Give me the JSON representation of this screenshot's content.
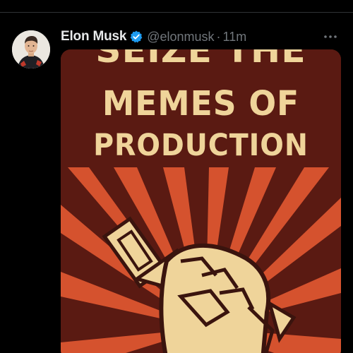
{
  "tweet": {
    "author": {
      "display_name": "Elon Musk",
      "handle": "@elonmusk",
      "verified": true
    },
    "separator": "·",
    "timestamp": "11m",
    "media": {
      "poster_lines": [
        "SEIZE THE",
        "MEMES OF",
        "PRODUCTION"
      ]
    }
  },
  "icons": {
    "verified": "verified-badge-icon",
    "more": "more-options-icon"
  },
  "colors": {
    "background": "#000000",
    "verified_badge": "#1d9bf0",
    "name_text": "#e7e9ea",
    "muted_text": "#71767b",
    "poster_background": "#5a1a12",
    "poster_rays": "#d5522e",
    "poster_text": "#efd49a"
  }
}
